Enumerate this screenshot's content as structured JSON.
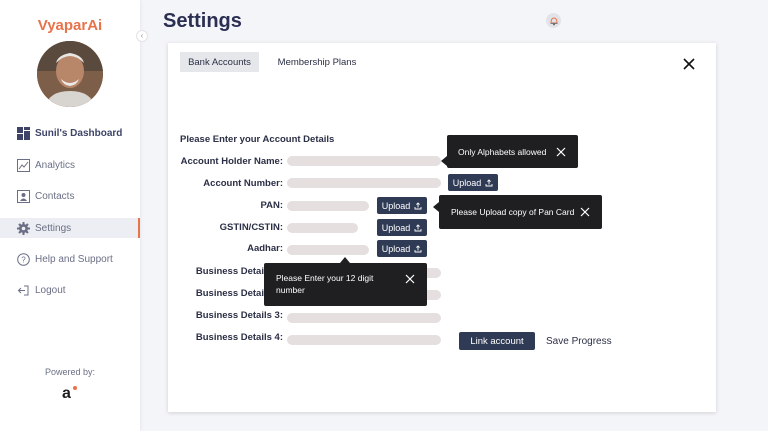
{
  "sidebar": {
    "brand": "VyaparAi",
    "items": [
      {
        "label": "Sunil's Dashboard",
        "icon": "dashboard-grid-icon"
      },
      {
        "label": "Analytics",
        "icon": "analytics-chart-icon"
      },
      {
        "label": "Contacts",
        "icon": "contacts-card-icon"
      },
      {
        "label": "Settings",
        "icon": "gear-icon"
      },
      {
        "label": "Help and Support",
        "icon": "help-circle-icon"
      },
      {
        "label": "Logout",
        "icon": "logout-icon"
      }
    ],
    "active_item": "Settings",
    "powered_by": "Powered by:"
  },
  "header": {
    "title": "Settings"
  },
  "card": {
    "tabs": [
      {
        "label": "Bank Accounts",
        "active": true
      },
      {
        "label": "Membership Plans",
        "active": false
      }
    ],
    "heading": "Please Enter your Account Details",
    "fields": {
      "account_holder": "Account Holder Name:",
      "account_number": "Account Number:",
      "pan": "PAN:",
      "gstin": "GSTIN/CSTIN:",
      "aadhar": "Aadhar:",
      "business_1": "Business Details 1:",
      "business_2": "Business Details 2:",
      "business_3": "Business Details 3:",
      "business_4": "Business Details 4:"
    },
    "upload_label": "Upload",
    "link_account": "Link account",
    "save_progress": "Save Progress"
  },
  "tooltips": {
    "name_hint": "Only Alphabets allowed",
    "pan_hint": "Please Upload copy of Pan Card",
    "aadhar_hint": "Please Enter your 12 digit number"
  },
  "colors": {
    "brand": "#e8734a",
    "primary_button": "#2f3a55",
    "tooltip_bg": "#1f1f22",
    "field_bg": "#e6dfe0"
  }
}
